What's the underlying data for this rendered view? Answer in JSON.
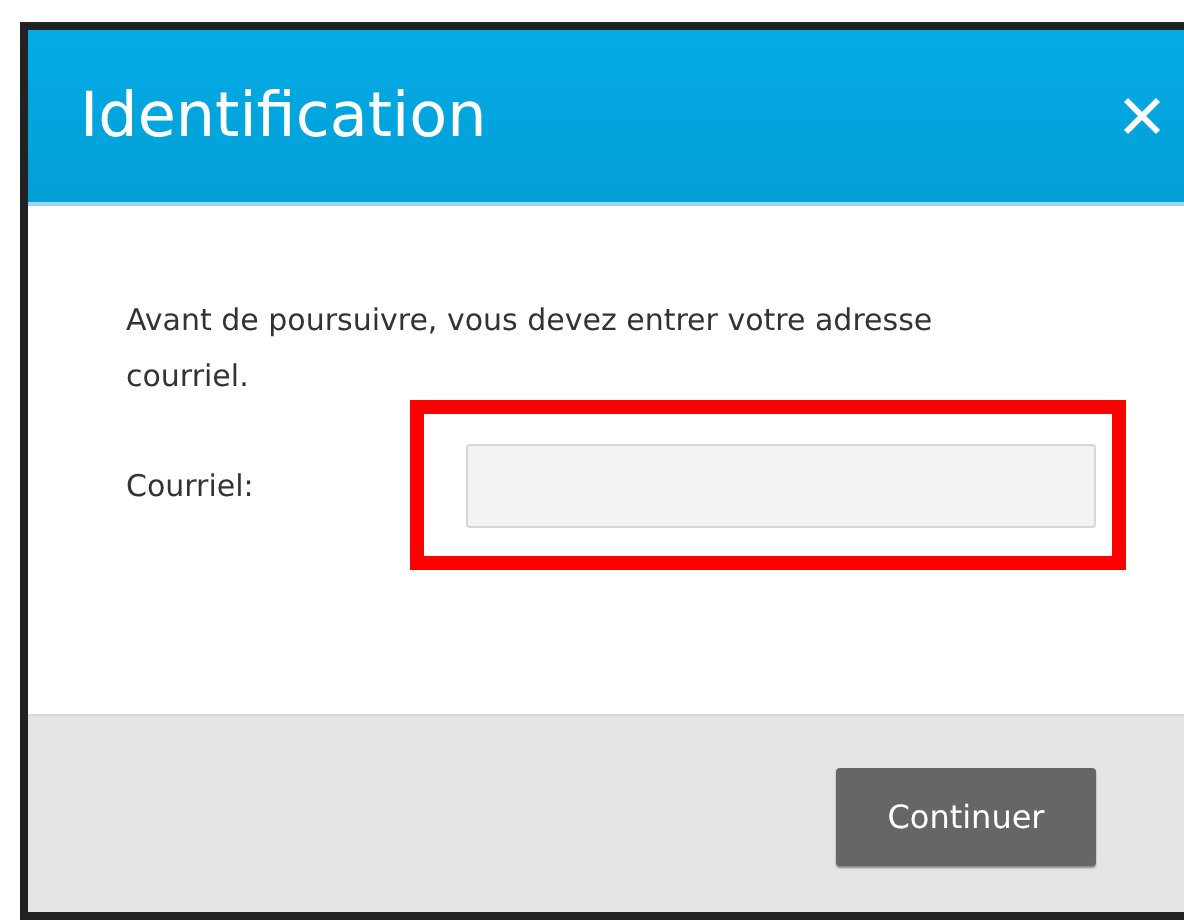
{
  "dialog": {
    "title": "Identification",
    "message": "Avant de poursuivre, vous devez entrer votre adresse courriel.",
    "field": {
      "label": "Courriel:",
      "highlighted": true
    },
    "buttons": [
      "Continuer"
    ]
  }
}
